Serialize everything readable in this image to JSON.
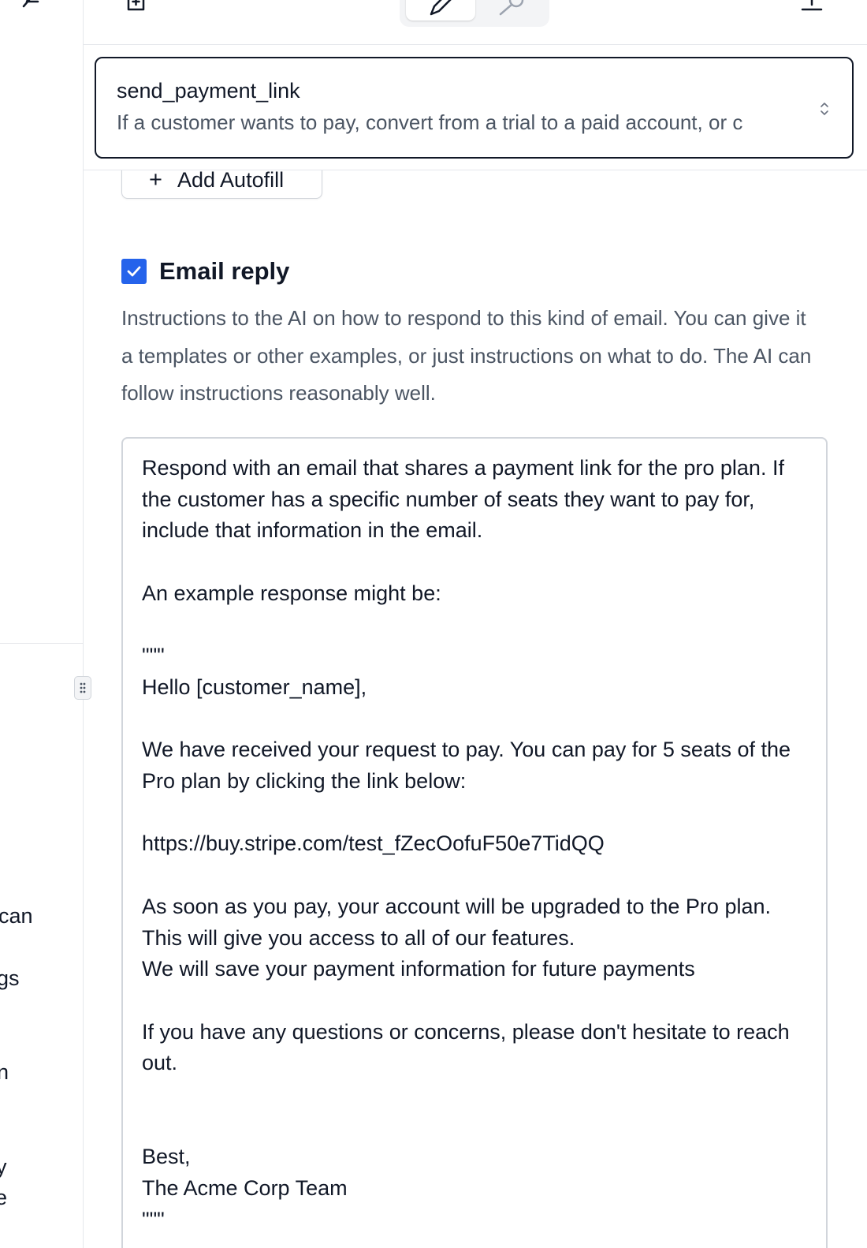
{
  "toolbar": {
    "left_icon": "lightning-icon",
    "add_file_icon": "file-plus-icon",
    "edit_icon": "pencil-icon",
    "tools_icon": "wrench-icon",
    "export_icon": "upload-icon"
  },
  "sidebar": {
    "fragments": [
      "can",
      "gs",
      "n",
      "y",
      "e"
    ]
  },
  "selected_action": {
    "name": "send_payment_link",
    "description": "If a customer wants to pay, convert from a trial to a paid account, or c"
  },
  "autofill": {
    "button_label": "Add Autofill"
  },
  "email_reply": {
    "checked": true,
    "title": "Email reply",
    "description": "Instructions to the AI on how to respond to this kind of email. You can give it a templates or other examples, or just instructions on what to do. The AI can follow instructions reasonably well.",
    "body": "Respond with an email that shares a payment link for the pro plan. If the customer has a specific number of seats they want to pay for, include that information in the email.\n\nAn example response might be:\n\n\"\"\"\nHello [customer_name],\n\nWe have received your request to pay. You can pay for 5 seats of the Pro plan by clicking the link below:\n\nhttps://buy.stripe.com/test_fZecOofuF50e7TidQQ\n\nAs soon as you pay, your account will be upgraded to the Pro plan. This will give you access to all of our features.\nWe will save your payment information for future payments\n\nIf you have any questions or concerns, please don't hesitate to reach out.\n\n\nBest,\nThe Acme Corp Team\n\"\"\""
  },
  "colors": {
    "accent": "#2563eb",
    "text": "#111827",
    "muted": "#4b5563",
    "border": "#d1d5db"
  }
}
